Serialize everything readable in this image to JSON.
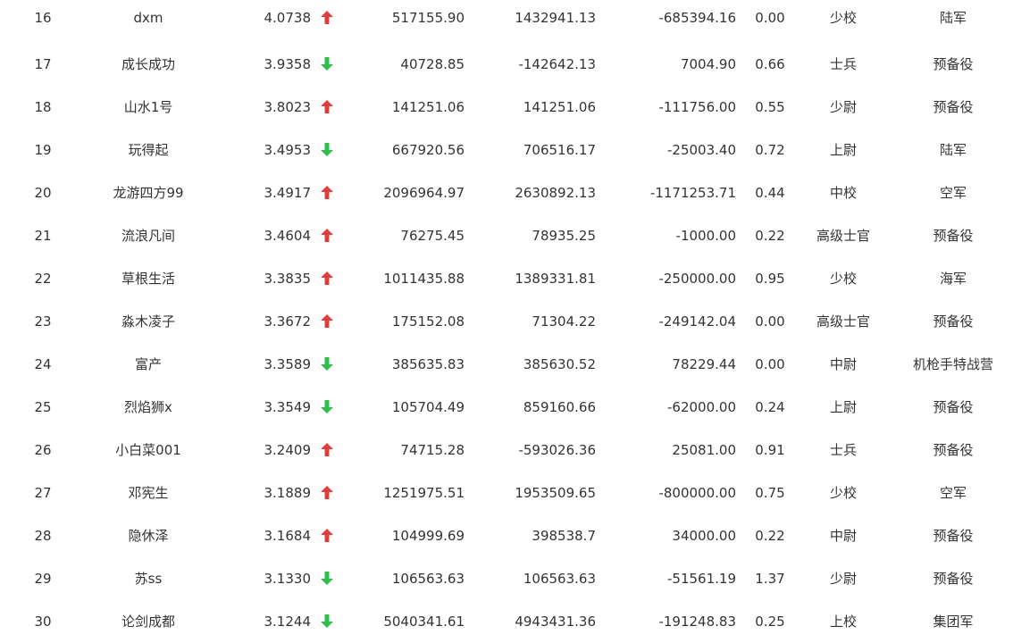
{
  "colors": {
    "up": "#e03c3c",
    "down": "#2fbf4a",
    "text": "#333333"
  },
  "rows": [
    {
      "rank": "16",
      "name": "dxm",
      "score": "4.0738",
      "trend": "up",
      "v1": "517155.90",
      "v2": "1432941.13",
      "v3": "-685394.16",
      "ratio": "0.00",
      "military_rank": "少校",
      "branch": "陆军"
    },
    {
      "rank": "17",
      "name": "成长成功",
      "score": "3.9358",
      "trend": "down",
      "v1": "40728.85",
      "v2": "-142642.13",
      "v3": "7004.90",
      "ratio": "0.66",
      "military_rank": "士兵",
      "branch": "预备役"
    },
    {
      "rank": "18",
      "name": "山水1号",
      "score": "3.8023",
      "trend": "up",
      "v1": "141251.06",
      "v2": "141251.06",
      "v3": "-111756.00",
      "ratio": "0.55",
      "military_rank": "少尉",
      "branch": "预备役"
    },
    {
      "rank": "19",
      "name": "玩得起",
      "score": "3.4953",
      "trend": "down",
      "v1": "667920.56",
      "v2": "706516.17",
      "v3": "-25003.40",
      "ratio": "0.72",
      "military_rank": "上尉",
      "branch": "陆军"
    },
    {
      "rank": "20",
      "name": "龙游四方99",
      "score": "3.4917",
      "trend": "up",
      "v1": "2096964.97",
      "v2": "2630892.13",
      "v3": "-1171253.71",
      "ratio": "0.44",
      "military_rank": "中校",
      "branch": "空军"
    },
    {
      "rank": "21",
      "name": "流浪凡间",
      "score": "3.4604",
      "trend": "up",
      "v1": "76275.45",
      "v2": "78935.25",
      "v3": "-1000.00",
      "ratio": "0.22",
      "military_rank": "高级士官",
      "branch": "预备役"
    },
    {
      "rank": "22",
      "name": "草根生活",
      "score": "3.3835",
      "trend": "up",
      "v1": "1011435.88",
      "v2": "1389331.81",
      "v3": "-250000.00",
      "ratio": "0.95",
      "military_rank": "少校",
      "branch": "海军"
    },
    {
      "rank": "23",
      "name": "淼木凌子",
      "score": "3.3672",
      "trend": "up",
      "v1": "175152.08",
      "v2": "71304.22",
      "v3": "-249142.04",
      "ratio": "0.00",
      "military_rank": "高级士官",
      "branch": "预备役"
    },
    {
      "rank": "24",
      "name": "富产",
      "score": "3.3589",
      "trend": "down",
      "v1": "385635.83",
      "v2": "385630.52",
      "v3": "78229.44",
      "ratio": "0.00",
      "military_rank": "中尉",
      "branch": "机枪手特战营"
    },
    {
      "rank": "25",
      "name": "烈焰狮x",
      "score": "3.3549",
      "trend": "down",
      "v1": "105704.49",
      "v2": "859160.66",
      "v3": "-62000.00",
      "ratio": "0.24",
      "military_rank": "上尉",
      "branch": "预备役"
    },
    {
      "rank": "26",
      "name": "小白菜001",
      "score": "3.2409",
      "trend": "up",
      "v1": "74715.28",
      "v2": "-593026.36",
      "v3": "25081.00",
      "ratio": "0.91",
      "military_rank": "士兵",
      "branch": "预备役"
    },
    {
      "rank": "27",
      "name": "邓宪生",
      "score": "3.1889",
      "trend": "up",
      "v1": "1251975.51",
      "v2": "1953509.65",
      "v3": "-800000.00",
      "ratio": "0.75",
      "military_rank": "少校",
      "branch": "空军"
    },
    {
      "rank": "28",
      "name": "隐休泽",
      "score": "3.1684",
      "trend": "up",
      "v1": "104999.69",
      "v2": "398538.7",
      "v3": "34000.00",
      "ratio": "0.22",
      "military_rank": "中尉",
      "branch": "预备役"
    },
    {
      "rank": "29",
      "name": "苏ss",
      "score": "3.1330",
      "trend": "down",
      "v1": "106563.63",
      "v2": "106563.63",
      "v3": "-51561.19",
      "ratio": "1.37",
      "military_rank": "少尉",
      "branch": "预备役"
    },
    {
      "rank": "30",
      "name": "论剑成都",
      "score": "3.1244",
      "trend": "down",
      "v1": "5040341.61",
      "v2": "4943431.36",
      "v3": "-191248.83",
      "ratio": "0.25",
      "military_rank": "上校",
      "branch": "集团军"
    }
  ]
}
